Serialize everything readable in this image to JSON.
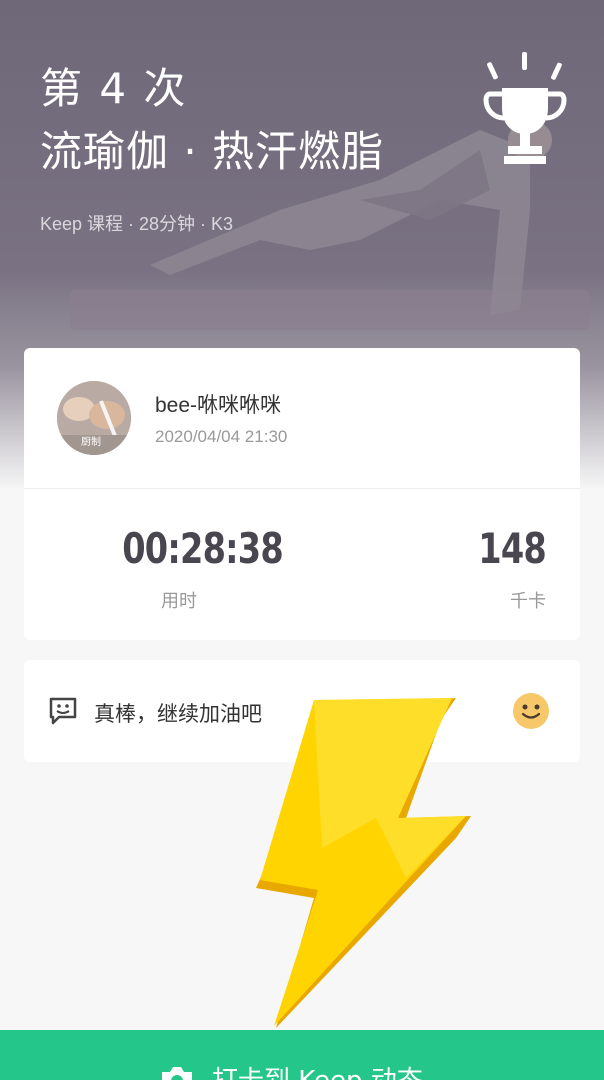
{
  "hero": {
    "count": "第 4 次",
    "title": "流瑜伽 · 热汗燃脂",
    "meta": "Keep 课程 · 28分钟 · K3",
    "trophy_icon": "trophy-icon"
  },
  "user": {
    "name": "bee-咻咪咻咪",
    "datetime": "2020/04/04 21:30",
    "avatar_caption": "厨制"
  },
  "stats": {
    "duration_value": "00:28:38",
    "duration_label": "用时",
    "calories_value": "148",
    "calories_label": "千卡"
  },
  "comment": {
    "text": "真棒，继续加油吧",
    "icon": "chat-bubble-icon",
    "emoji_icon": "smile-emoji-icon"
  },
  "cta": {
    "label": "打卡到 Keep 动态",
    "icon": "camera-icon",
    "color": "#24c789"
  },
  "colors": {
    "accent": "#24c789",
    "bolt": "#ffd400"
  }
}
